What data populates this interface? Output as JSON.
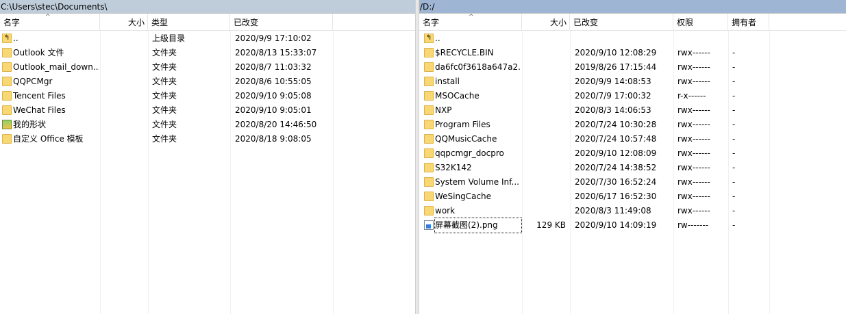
{
  "left": {
    "path": "C:\\Users\\stec\\Documents\\",
    "columns": {
      "name": "名字",
      "size": "大小",
      "type": "类型",
      "modified": "已改变"
    },
    "rows": [
      {
        "name": "..",
        "icon": "up-folder-icon",
        "type": "上级目录",
        "modified": "2020/9/9  17:10:02"
      },
      {
        "name": "Outlook 文件",
        "icon": "folder-icon",
        "type": "文件夹",
        "modified": "2020/8/13  15:33:07"
      },
      {
        "name": "Outlook_mail_down...",
        "icon": "folder-icon",
        "type": "文件夹",
        "modified": "2020/8/7  11:03:32"
      },
      {
        "name": "QQPCMgr",
        "icon": "folder-icon",
        "type": "文件夹",
        "modified": "2020/8/6  10:55:05"
      },
      {
        "name": "Tencent Files",
        "icon": "folder-icon",
        "type": "文件夹",
        "modified": "2020/9/10  9:05:08"
      },
      {
        "name": "WeChat Files",
        "icon": "folder-icon",
        "type": "文件夹",
        "modified": "2020/9/10  9:05:01"
      },
      {
        "name": "我的形状",
        "icon": "shapes-app-icon",
        "type": "文件夹",
        "modified": "2020/8/20  14:46:50"
      },
      {
        "name": "自定义 Office 模板",
        "icon": "folder-icon",
        "type": "文件夹",
        "modified": "2020/8/18  9:08:05"
      }
    ]
  },
  "right": {
    "path": "/D:/",
    "columns": {
      "name": "名字",
      "size": "大小",
      "modified": "已改变",
      "permissions": "权限",
      "owner": "拥有者"
    },
    "rows": [
      {
        "name": "..",
        "icon": "up-folder-icon",
        "size": "",
        "modified": "",
        "permissions": "",
        "owner": ""
      },
      {
        "name": "$RECYCLE.BIN",
        "icon": "folder-icon",
        "size": "",
        "modified": "2020/9/10 12:08:29",
        "permissions": "rwx------",
        "owner": "-"
      },
      {
        "name": "da6fc0f3618a647a2...",
        "icon": "folder-icon",
        "size": "",
        "modified": "2019/8/26 17:15:44",
        "permissions": "rwx------",
        "owner": "-"
      },
      {
        "name": "install",
        "icon": "folder-icon",
        "size": "",
        "modified": "2020/9/9 14:08:53",
        "permissions": "rwx------",
        "owner": "-"
      },
      {
        "name": "MSOCache",
        "icon": "folder-icon",
        "size": "",
        "modified": "2020/7/9 17:00:32",
        "permissions": "r-x------",
        "owner": "-"
      },
      {
        "name": "NXP",
        "icon": "folder-icon",
        "size": "",
        "modified": "2020/8/3 14:06:53",
        "permissions": "rwx------",
        "owner": "-"
      },
      {
        "name": "Program Files",
        "icon": "folder-icon",
        "size": "",
        "modified": "2020/7/24 10:30:28",
        "permissions": "rwx------",
        "owner": "-"
      },
      {
        "name": "QQMusicCache",
        "icon": "folder-icon",
        "size": "",
        "modified": "2020/7/24 10:57:48",
        "permissions": "rwx------",
        "owner": "-"
      },
      {
        "name": "qqpcmgr_docpro",
        "icon": "folder-icon",
        "size": "",
        "modified": "2020/9/10 12:08:09",
        "permissions": "rwx------",
        "owner": "-"
      },
      {
        "name": "S32K142",
        "icon": "folder-icon",
        "size": "",
        "modified": "2020/7/24 14:38:52",
        "permissions": "rwx------",
        "owner": "-"
      },
      {
        "name": "System Volume Inf...",
        "icon": "folder-icon",
        "size": "",
        "modified": "2020/7/30 16:52:24",
        "permissions": "rwx------",
        "owner": "-"
      },
      {
        "name": "WeSingCache",
        "icon": "folder-icon",
        "size": "",
        "modified": "2020/6/17 16:52:30",
        "permissions": "rwx------",
        "owner": "-"
      },
      {
        "name": "work",
        "icon": "folder-icon",
        "size": "",
        "modified": "2020/8/3 11:49:08",
        "permissions": "rwx------",
        "owner": "-"
      },
      {
        "name": "屏幕截图(2).png",
        "icon": "png-file-icon",
        "size": "129 KB",
        "modified": "2020/9/10 14:09:19",
        "permissions": "rw-------",
        "owner": "-"
      }
    ]
  }
}
